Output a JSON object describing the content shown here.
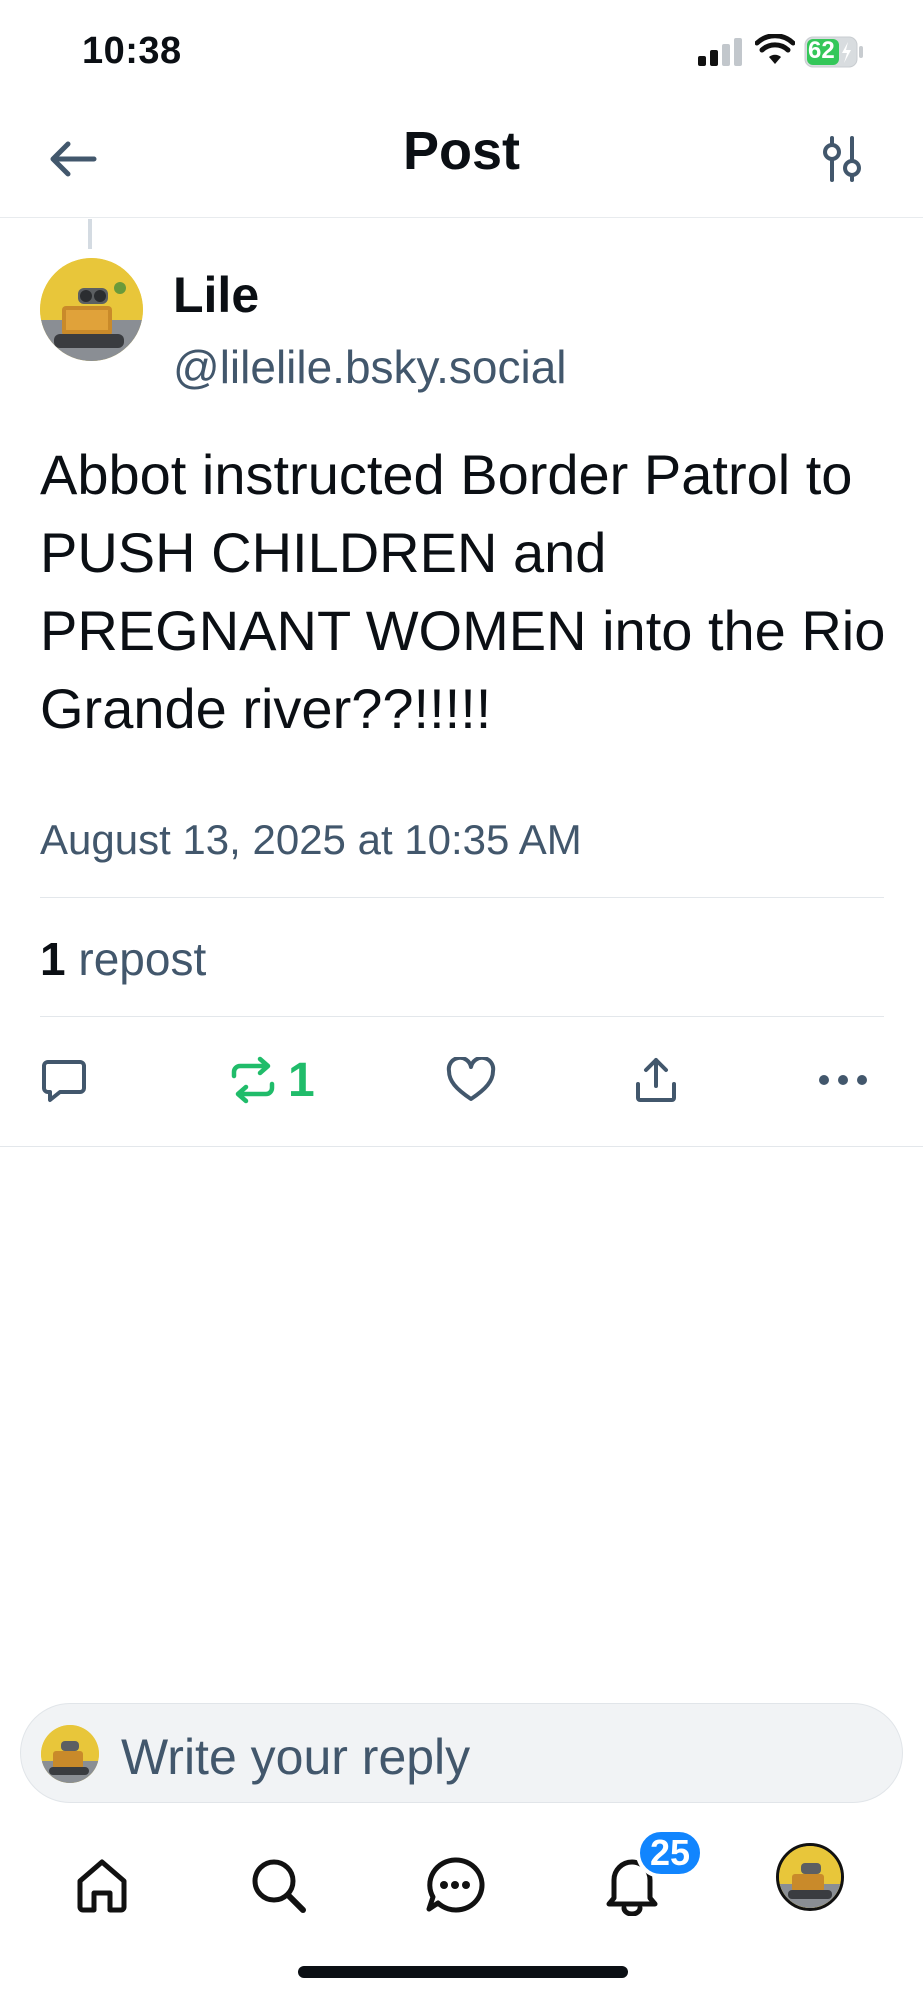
{
  "status_bar": {
    "time": "10:38",
    "battery": "62"
  },
  "header": {
    "title": "Post"
  },
  "post": {
    "author_name": "Lile",
    "author_handle": "@lilelile.bsky.social",
    "text": "Abbot instructed Border Patrol to PUSH CHILDREN and PREGNANT WOMEN into the Rio Grande river??!!!!!",
    "timestamp": "August 13, 2025 at 10:35 AM",
    "repost_count": "1",
    "repost_label": "repost",
    "actions": {
      "reply_icon": "comment-icon",
      "repost_icon": "repost-icon",
      "repost_count": "1",
      "like_icon": "heart-icon",
      "share_icon": "share-icon",
      "more_icon": "more-icon"
    }
  },
  "reply_bar": {
    "placeholder": "Write your reply"
  },
  "tab_bar": {
    "items": [
      "home-icon",
      "search-icon",
      "chat-icon",
      "bell-icon",
      "profile-avatar"
    ],
    "notification_badge": "25"
  },
  "colors": {
    "text_primary": "#0b0f14",
    "text_secondary": "#42576c",
    "repost_green": "#20bc6a",
    "badge_blue": "#1185fe",
    "battery_green": "#34c759"
  }
}
